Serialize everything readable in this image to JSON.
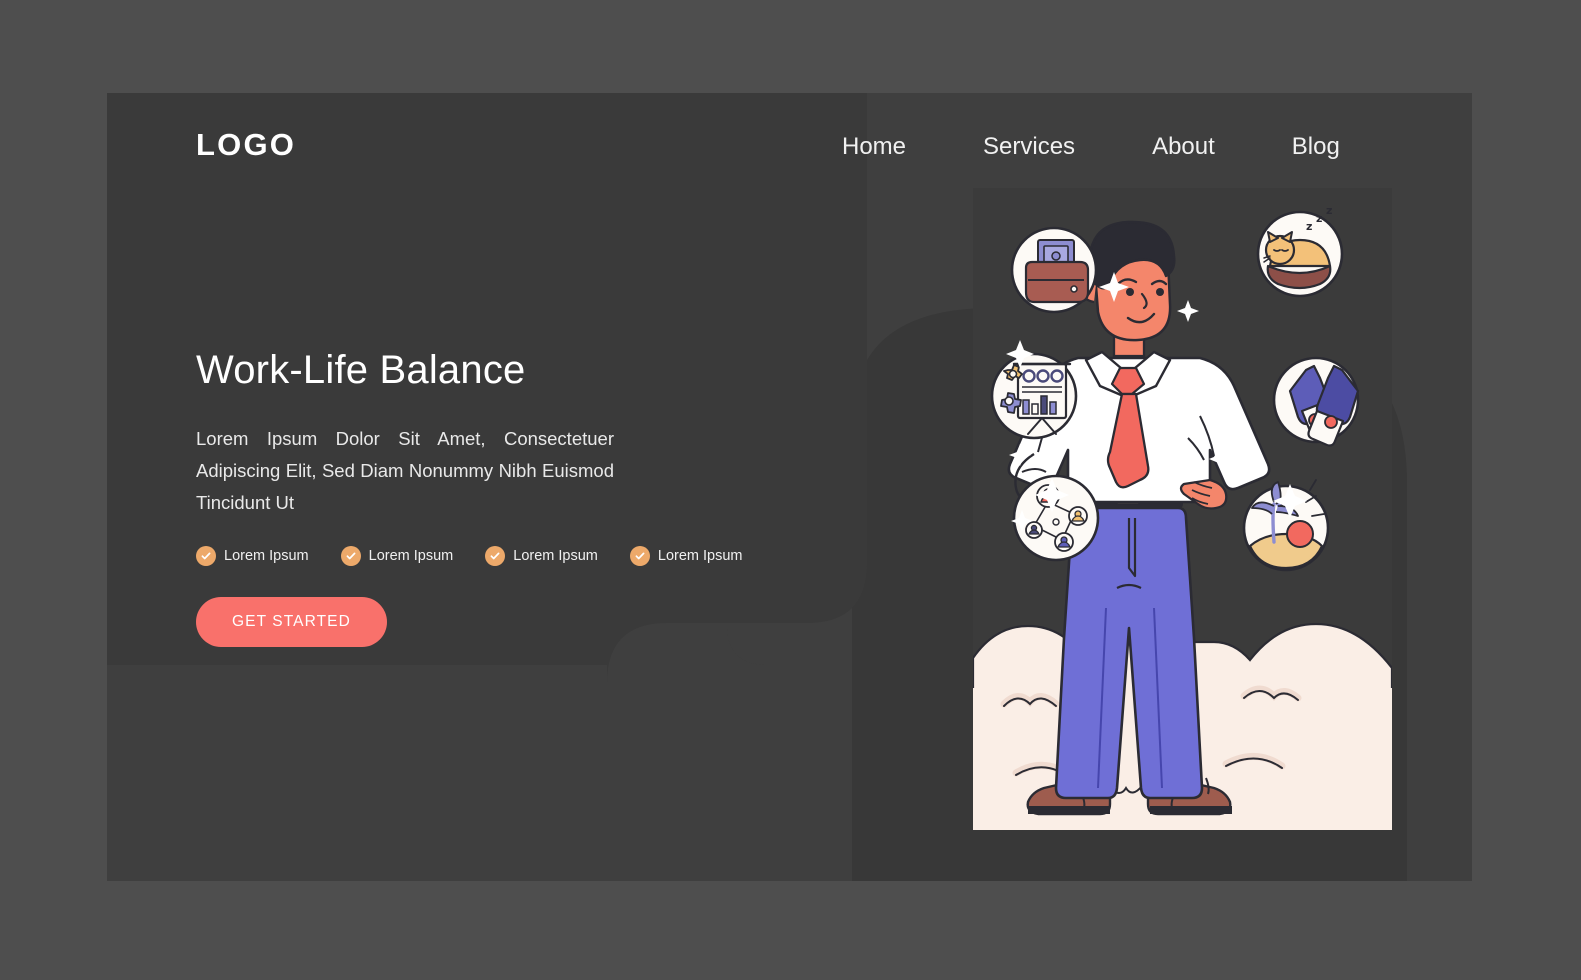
{
  "theme": {
    "page_bg": "#4e4e4e",
    "card_bg": "#3f3f3f",
    "overlay_bg": "#383838",
    "accent_cta": "#f9716b",
    "accent_check": "#eda96a",
    "ground_cream": "#faeee6",
    "text_primary": "#ffffff",
    "text_body": "#e9e9e9"
  },
  "header": {
    "logo": "LOGO",
    "nav": [
      {
        "label": "Home"
      },
      {
        "label": "Services"
      },
      {
        "label": "About"
      },
      {
        "label": "Blog"
      }
    ]
  },
  "hero": {
    "title": "Work-Life Balance",
    "body": "Lorem Ipsum Dolor Sit Amet, Consectetuer Adipiscing Elit, Sed Diam Nonummy Nibh Euismod Tincidunt Ut",
    "features": [
      {
        "label": "Lorem Ipsum",
        "icon": "check-icon"
      },
      {
        "label": "Lorem Ipsum",
        "icon": "check-icon"
      },
      {
        "label": "Lorem Ipsum",
        "icon": "check-icon"
      },
      {
        "label": "Lorem Ipsum",
        "icon": "check-icon"
      }
    ],
    "cta_label": "GET STARTED"
  },
  "illustration": {
    "description": "Businessman standing with hands on hips surrounded by lifestyle icon bubbles",
    "character": {
      "shirt": "#ffffff",
      "tie": "#f2695f",
      "trousers": "#6f6fd6",
      "shoes": "#9e5c4e",
      "skin": "#f4866b",
      "hair": "#2b2b33",
      "belt": "#2b2b33"
    },
    "bubbles": [
      {
        "name": "wallet-money-icon",
        "label": "Money"
      },
      {
        "name": "sleeping-cat-icon",
        "label": "Rest"
      },
      {
        "name": "chart-presentation-gears-icon",
        "label": "Work"
      },
      {
        "name": "clinking-bottles-icon",
        "label": "Celebration"
      },
      {
        "name": "social-network-icon",
        "label": "Social"
      },
      {
        "name": "beach-palm-sunset-icon",
        "label": "Vacation"
      }
    ],
    "sparkles": 7
  }
}
